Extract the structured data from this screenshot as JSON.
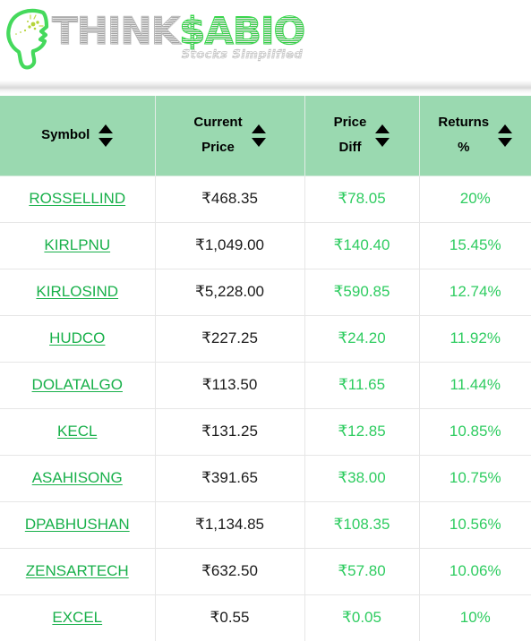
{
  "brand": {
    "logo_icon": "thinking-head-icon",
    "name_part1": "THINK",
    "name_part2": "$ABIO",
    "tagline": "Stocks Simplified",
    "accent_green": "#3cd94f",
    "header_green": "#9ad9b0"
  },
  "table": {
    "columns": [
      {
        "key": "symbol",
        "label": "Symbol",
        "sort_icon": "sort-arrows-icon"
      },
      {
        "key": "current",
        "label": "Current\nPrice",
        "sort_icon": "sort-arrows-icon"
      },
      {
        "key": "diff",
        "label": "Price\nDiff",
        "sort_icon": "sort-arrows-icon"
      },
      {
        "key": "returns",
        "label": "Returns\n%",
        "sort_icon": "sort-arrows-icon"
      }
    ],
    "rows": [
      {
        "symbol": "ROSSELLIND",
        "current": "₹468.35",
        "diff": "₹78.05",
        "returns": "20%"
      },
      {
        "symbol": "KIRLPNU",
        "current": "₹1,049.00",
        "diff": "₹140.40",
        "returns": "15.45%"
      },
      {
        "symbol": "KIRLOSIND",
        "current": "₹5,228.00",
        "diff": "₹590.85",
        "returns": "12.74%"
      },
      {
        "symbol": "HUDCO",
        "current": "₹227.25",
        "diff": "₹24.20",
        "returns": "11.92%"
      },
      {
        "symbol": "DOLATALGO",
        "current": "₹113.50",
        "diff": "₹11.65",
        "returns": "11.44%"
      },
      {
        "symbol": "KECL",
        "current": "₹131.25",
        "diff": "₹12.85",
        "returns": "10.85%"
      },
      {
        "symbol": "ASAHISONG",
        "current": "₹391.65",
        "diff": "₹38.00",
        "returns": "10.75%"
      },
      {
        "symbol": "DPABHUSHAN",
        "current": "₹1,134.85",
        "diff": "₹108.35",
        "returns": "10.56%"
      },
      {
        "symbol": "ZENSARTECH",
        "current": "₹632.50",
        "diff": "₹57.80",
        "returns": "10.06%"
      },
      {
        "symbol": "EXCEL",
        "current": "₹0.55",
        "diff": "₹0.05",
        "returns": "10%"
      }
    ]
  }
}
